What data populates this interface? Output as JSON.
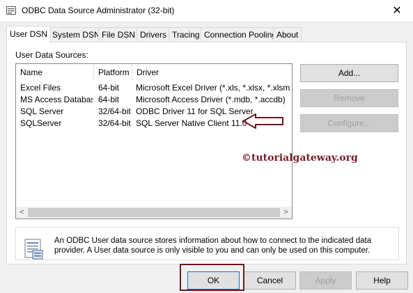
{
  "window": {
    "title": "ODBC Data Source Administrator (32-bit)",
    "close_glyph": "✕"
  },
  "tabs": [
    {
      "label": "User DSN",
      "active": true
    },
    {
      "label": "System DSN"
    },
    {
      "label": "File DSN"
    },
    {
      "label": "Drivers"
    },
    {
      "label": "Tracing"
    },
    {
      "label": "Connection Pooling"
    },
    {
      "label": "About"
    }
  ],
  "panel": {
    "sources_label": "User Data Sources:",
    "columns": [
      "Name",
      "Platform",
      "Driver"
    ],
    "rows": [
      {
        "name": "Excel Files",
        "platform": "64-bit",
        "driver": "Microsoft Excel Driver (*.xls, *.xlsx, *.xlsm, *.xlsb)"
      },
      {
        "name": "MS Access Database",
        "platform": "64-bit",
        "driver": "Microsoft Access Driver (*.mdb, *.accdb)"
      },
      {
        "name": "SQL Server",
        "platform": "32/64-bit",
        "driver": "ODBC Driver 11 for SQL Server"
      },
      {
        "name": "SQLServer",
        "platform": "32/64-bit",
        "driver": "SQL Server Native Client 11.0"
      }
    ],
    "scroll_left": "<",
    "scroll_right": ">",
    "buttons": {
      "add": "Add...",
      "remove": "Remove",
      "configure": "Configure..."
    },
    "info_text": "An ODBC User data source stores information about how to connect to the indicated data provider.  A User data source is only visible to you and can only be used on this computer."
  },
  "footer": {
    "ok": "OK",
    "cancel": "Cancel",
    "apply": "Apply",
    "help": "Help"
  },
  "watermark": "©tutorialgateway.org",
  "colors": {
    "annotation": "#6e1620",
    "panel_bg": "#ffffff",
    "client_bg": "#f0f0f0"
  }
}
